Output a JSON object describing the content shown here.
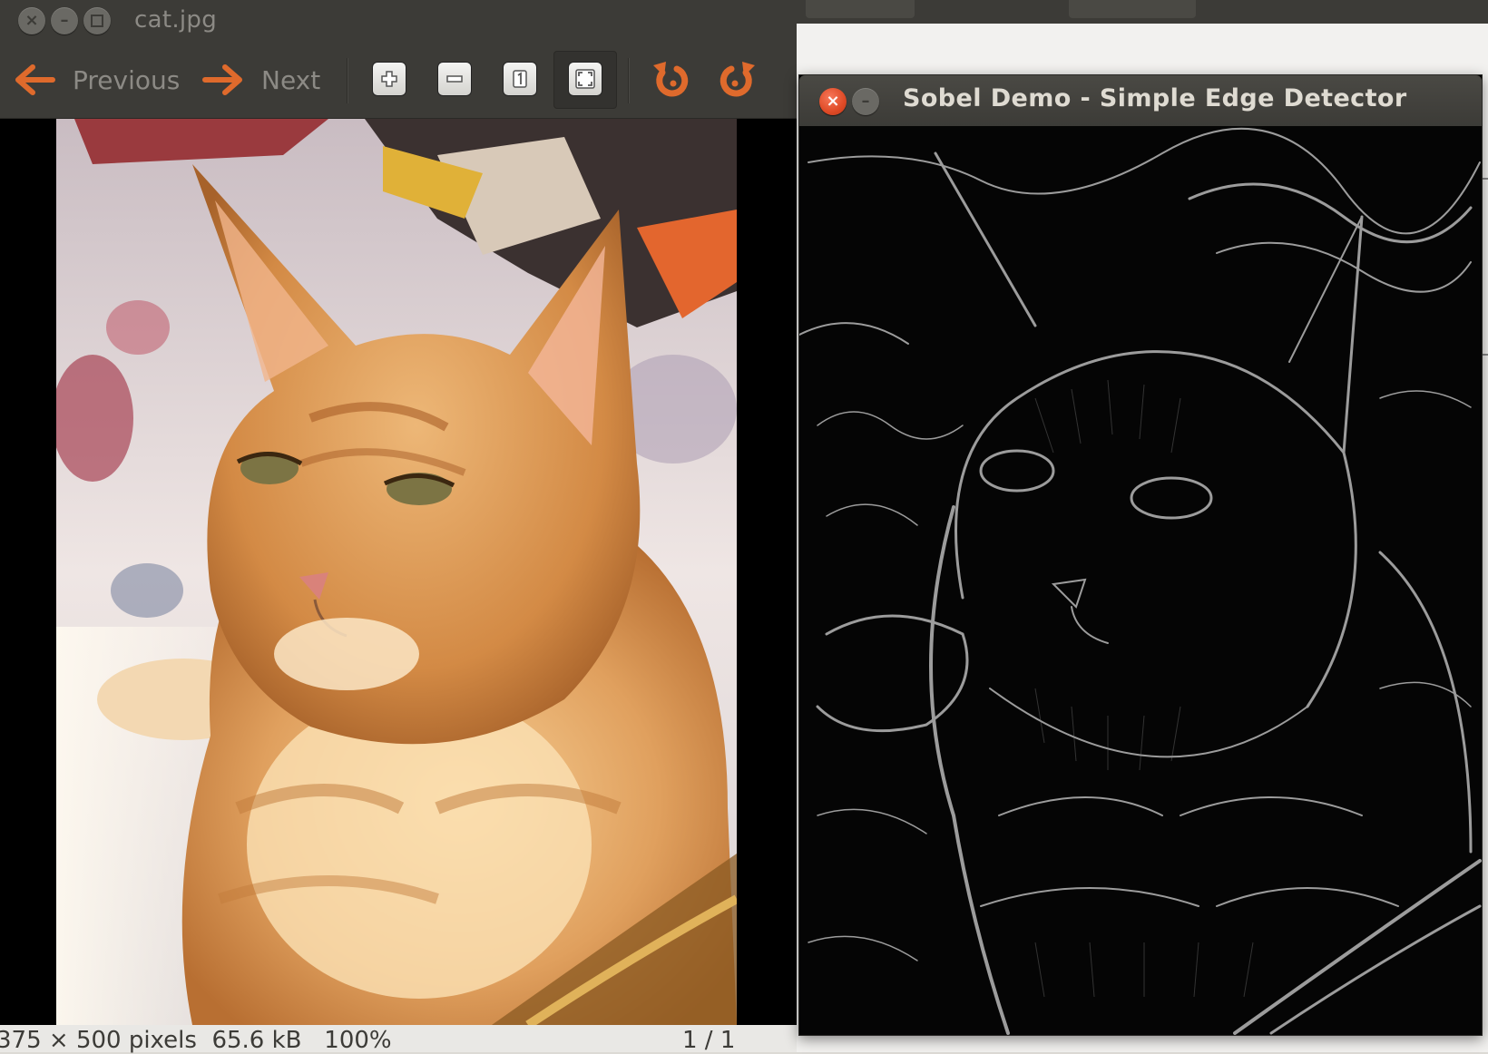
{
  "viewer": {
    "title": "cat.jpg",
    "toolbar": {
      "previous_label": "Previous",
      "next_label": "Next"
    },
    "statusbar": {
      "info": "375 × 500 pixels  65.6 kB   100%",
      "page": "1 / 1"
    }
  },
  "sobel": {
    "title": "Sobel Demo - Simple Edge Detector"
  },
  "icons": {
    "previous": "arrow-left-icon",
    "next": "arrow-right-icon",
    "zoom_in": "zoom-in-icon",
    "zoom_out": "zoom-out-icon",
    "zoom_normal": "zoom-original-icon",
    "best_fit": "zoom-fit-icon",
    "rotate_left": "rotate-left-icon",
    "rotate_right": "rotate-right-icon"
  },
  "colors": {
    "accent_orange": "#df6a2c",
    "titlebar": "#3c3b37",
    "close_red": "#df4a26"
  }
}
